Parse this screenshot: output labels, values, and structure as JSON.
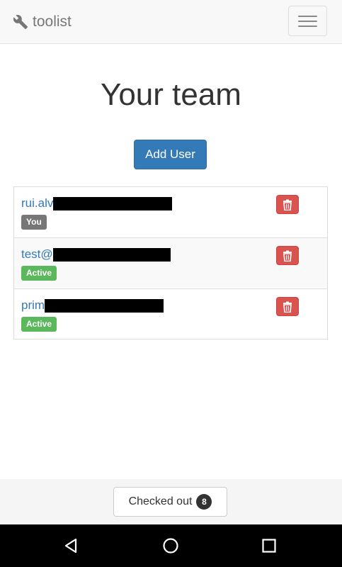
{
  "navbar": {
    "brand": "toolist",
    "brand_icon": "wrench-icon",
    "menu_icon": "hamburger-menu-icon"
  },
  "page": {
    "title": "Your team",
    "add_user_label": "Add User"
  },
  "users": [
    {
      "email": "rui.alv",
      "badge": "You",
      "badge_color": "#777777",
      "delete_icon": "trash-icon"
    },
    {
      "email": "test@",
      "badge": "Active",
      "badge_color": "#5cb85c",
      "delete_icon": "trash-icon"
    },
    {
      "email": "prim",
      "badge": "Active",
      "badge_color": "#5cb85c",
      "delete_icon": "trash-icon"
    }
  ],
  "footer": {
    "checked_out_label": "Checked out",
    "checked_out_count": "8"
  },
  "system_nav": {
    "back_icon": "back-triangle-icon",
    "home_icon": "home-circle-icon",
    "recents_icon": "recents-square-icon"
  },
  "colors": {
    "primary": "#337ab7",
    "danger": "#d9534f",
    "success": "#5cb85c"
  }
}
